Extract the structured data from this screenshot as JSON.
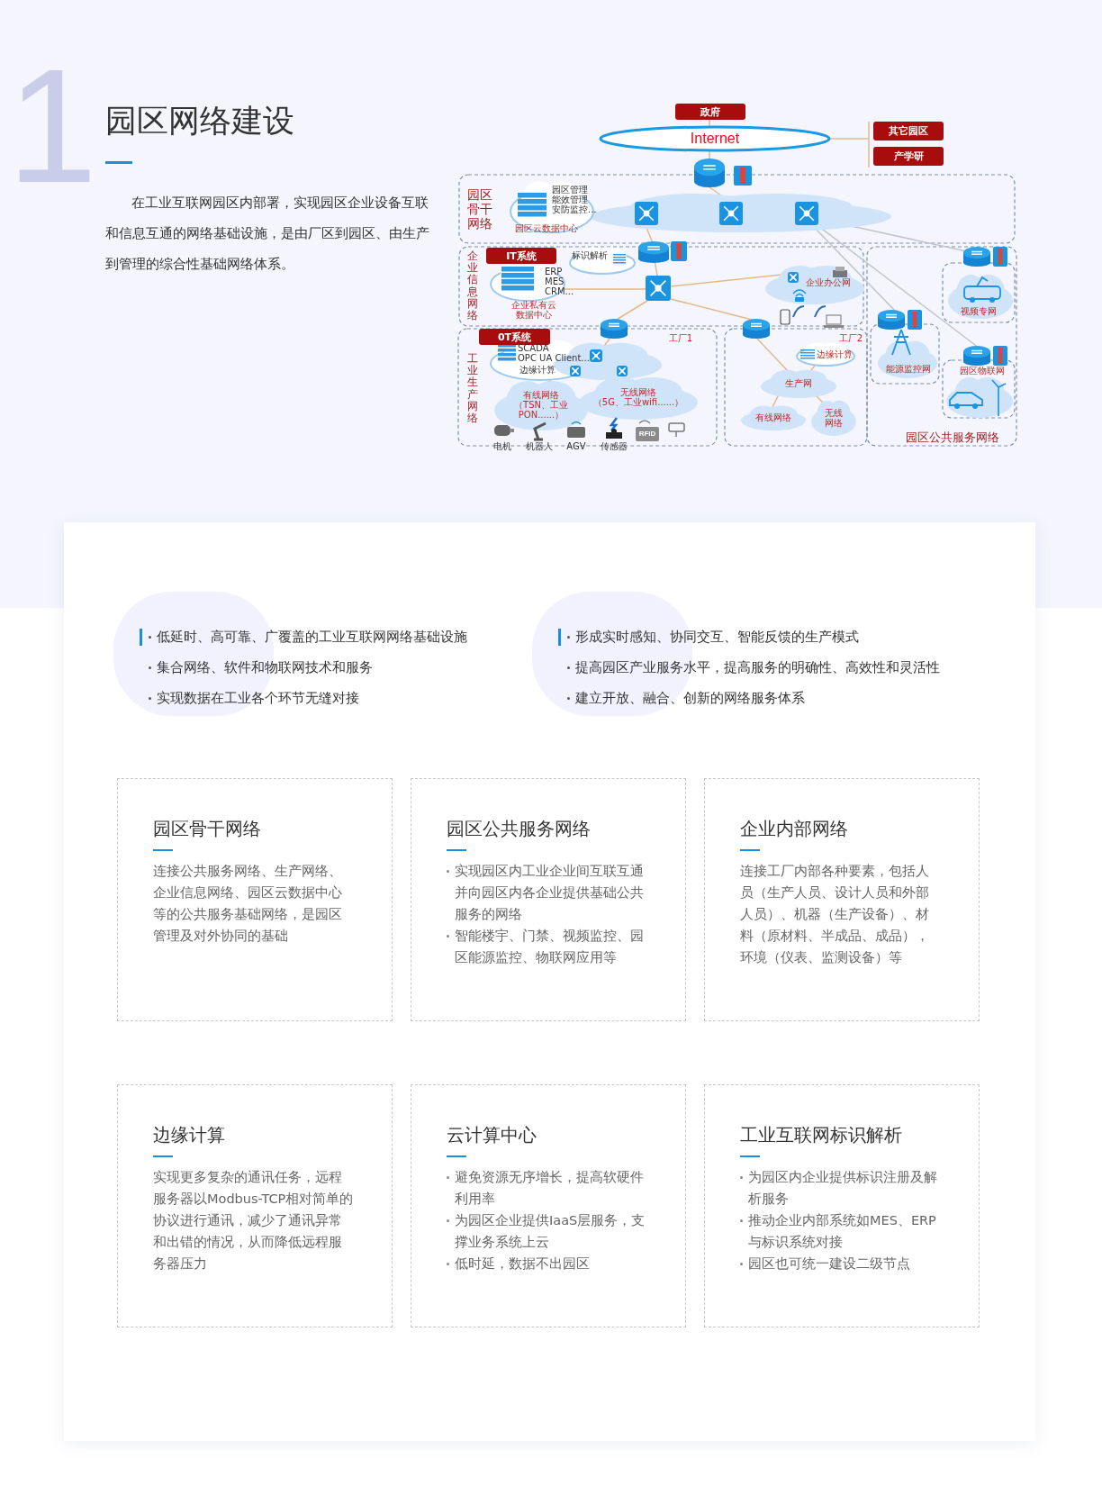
{
  "section_number": "1",
  "title": "园区网络建设",
  "intro": "在工业互联网园区内部署，实现园区企业设备互联和信息互通的网络基础设施，是由厂区到园区、由生产到管理的综合性基础网络体系。",
  "diagram": {
    "labels": [
      {
        "kind": "tag",
        "text": "政府"
      },
      {
        "kind": "internet",
        "text": "Internet"
      },
      {
        "kind": "tag",
        "text": "其它园区"
      },
      {
        "kind": "tag",
        "text": "产学研"
      },
      {
        "kind": "zone",
        "text": "园区骨干网络"
      },
      {
        "kind": "list",
        "lines": [
          "园区管理",
          "能效管理",
          "安防监控..."
        ]
      },
      {
        "kind": "caption",
        "text": "园区云数据中心"
      },
      {
        "kind": "zone-vertical",
        "text": "企业信息网络"
      },
      {
        "kind": "tag",
        "text": "IT系统"
      },
      {
        "kind": "list",
        "lines": [
          "标识解析"
        ]
      },
      {
        "kind": "list",
        "lines": [
          "ERP",
          "MES",
          "CRM..."
        ]
      },
      {
        "kind": "caption",
        "text": "企业私有云数据中心"
      },
      {
        "kind": "cloud",
        "lines": [
          "企业办公网"
        ]
      },
      {
        "kind": "tag",
        "text": "0T系统"
      },
      {
        "kind": "list",
        "lines": [
          "SCADA",
          "OPC UA Client..."
        ]
      },
      {
        "kind": "list",
        "lines": [
          "边缘计算"
        ]
      },
      {
        "kind": "caption",
        "text": "工厂1"
      },
      {
        "kind": "zone-vertical",
        "text": "工业生产网络"
      },
      {
        "kind": "cloud",
        "lines": [
          "有线网络",
          "（TSN、工业",
          "PON......）"
        ]
      },
      {
        "kind": "cloud",
        "lines": [
          "无线网络",
          "（5G、工业wifi......）"
        ]
      },
      {
        "kind": "device",
        "text": "电机"
      },
      {
        "kind": "device",
        "text": "机器人"
      },
      {
        "kind": "device",
        "text": "AGV"
      },
      {
        "kind": "device",
        "text": "传感器"
      },
      {
        "kind": "rfid",
        "text": "RFID"
      },
      {
        "kind": "caption",
        "text": "工厂2"
      },
      {
        "kind": "cloud",
        "lines": [
          "边缘计算"
        ]
      },
      {
        "kind": "cloud",
        "lines": [
          "生产网"
        ]
      },
      {
        "kind": "cloud",
        "lines": [
          "有线网络"
        ]
      },
      {
        "kind": "cloud",
        "lines": [
          "无线",
          "网络"
        ]
      },
      {
        "kind": "caption",
        "text": "视频专网"
      },
      {
        "kind": "caption",
        "text": "能源监控网"
      },
      {
        "kind": "caption",
        "text": "园区物联网"
      },
      {
        "kind": "zone-caption",
        "text": "园区公共服务网络"
      }
    ]
  },
  "highlights": [
    [
      "低延时、高可靠、广覆盖的工业互联网网络基础设施",
      "集合网络、软件和物联网技术和服务",
      "实现数据在工业各个环节无缝对接"
    ],
    [
      "形成实时感知、协同交互、智能反馈的生产模式",
      "提高园区产业服务水平，提高服务的明确性、高效性和灵活性",
      "建立开放、融合、创新的网络服务体系"
    ]
  ],
  "cards": [
    {
      "title": "园区骨干网络",
      "kind": "paragraph",
      "text": "连接公共服务网络、生产网络、企业信息网络、园区云数据中心等的公共服务基础网络，是园区管理及对外协同的基础"
    },
    {
      "title": "园区公共服务网络",
      "kind": "bullets",
      "items": [
        "实现园区内工业企业间互联互通并向园区内各企业提供基础公共服务的网络",
        "智能楼宇、门禁、视频监控、园区能源监控、物联网应用等"
      ]
    },
    {
      "title": "企业内部网络",
      "kind": "paragraph",
      "text": "连接工厂内部各种要素，包括人员（生产人员、设计人员和外部人员）、机器（生产设备）、材料（原材料、半成品、成品），环境（仪表、监测设备）等"
    },
    {
      "title": "边缘计算",
      "kind": "paragraph",
      "text": "实现更多复杂的通讯任务，远程服务器以Modbus-TCP相对简单的协议进行通讯，减少了通讯异常和出错的情况，从而降低远程服务器压力"
    },
    {
      "title": "云计算中心",
      "kind": "bullets",
      "items": [
        "避免资源无序增长，提高软硬件利用率",
        "为园区企业提供IaaS层服务，支撑业务系统上云",
        "低时延，数据不出园区"
      ]
    },
    {
      "title": "工业互联网标识解析",
      "kind": "bullets",
      "items": [
        "为园区内企业提供标识注册及解析服务",
        "推动企业内部系统如MES、ERP与标识系统对接",
        "园区也可统一建设二级节点"
      ]
    }
  ]
}
